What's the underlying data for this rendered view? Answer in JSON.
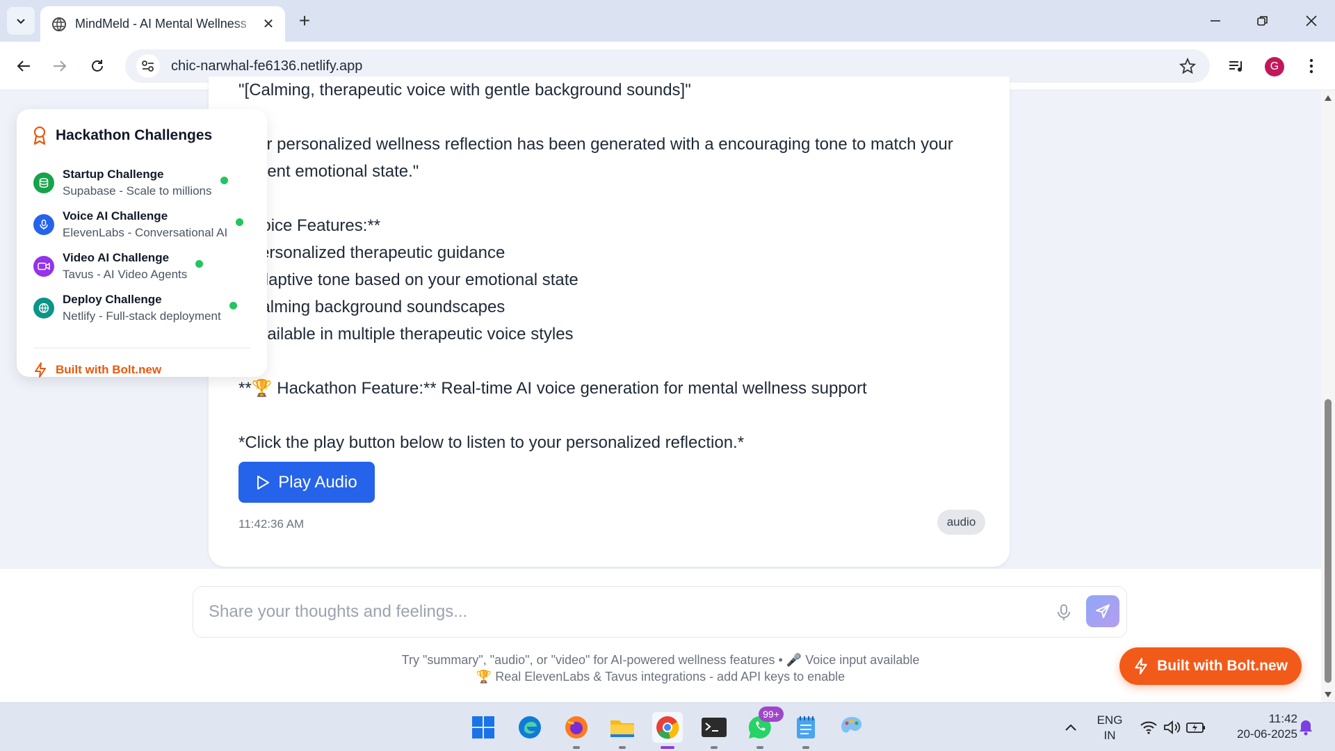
{
  "browser": {
    "tab_title": "MindMeld - AI Mental Wellness",
    "url": "chic-narwhal-fe6136.netlify.app",
    "profile_initial": "G"
  },
  "message": {
    "lines": [
      "\"[Calming, therapeutic voice with gentle background sounds]\"",
      "",
      "Your personalized wellness reflection has been generated with a encouraging tone to match your",
      "current emotional state.\"",
      "",
      "**Voice Features:**",
      "• Personalized therapeutic guidance",
      "• Adaptive tone based on your emotional state",
      "• Calming background soundscapes",
      "• Available in multiple therapeutic voice styles",
      "",
      "**🏆 Hackathon Feature:** Real-time AI voice generation for mental wellness support",
      "",
      "*Click the play button below to listen to your personalized reflection.*"
    ],
    "play_label": "Play Audio",
    "timestamp": "11:42:36 AM",
    "type_badge": "audio"
  },
  "challenges": {
    "title": "Hackathon Challenges",
    "items": [
      {
        "name": "Startup Challenge",
        "sub": "Supabase - Scale to millions",
        "color": "#16a34a",
        "icon": "database-icon"
      },
      {
        "name": "Voice AI Challenge",
        "sub": "ElevenLabs - Conversational AI",
        "color": "#2563eb",
        "icon": "microphone-icon"
      },
      {
        "name": "Video AI Challenge",
        "sub": "Tavus - AI Video Agents",
        "color": "#9333ea",
        "icon": "video-icon"
      },
      {
        "name": "Deploy Challenge",
        "sub": "Netlify - Full-stack deployment",
        "color": "#0d9488",
        "icon": "globe-icon"
      }
    ],
    "footer": "Built with Bolt.new"
  },
  "composer": {
    "placeholder": "Share your thoughts and feelings...",
    "hint_line1": "Try \"summary\", \"audio\", or \"video\" for AI-powered wellness features • 🎤 Voice input available",
    "hint_line2": "🏆 Real ElevenLabs & Tavus integrations - add API keys to enable"
  },
  "bolt_badge": "Built with Bolt.new",
  "taskbar": {
    "whatsapp_badge": "99+",
    "lang_line1": "ENG",
    "lang_line2": "IN",
    "time": "11:42",
    "date": "20-06-2025"
  },
  "colors": {
    "primary_button": "#2563eb",
    "bolt_orange": "#f25a1a",
    "status_dot": "#22c55e"
  }
}
